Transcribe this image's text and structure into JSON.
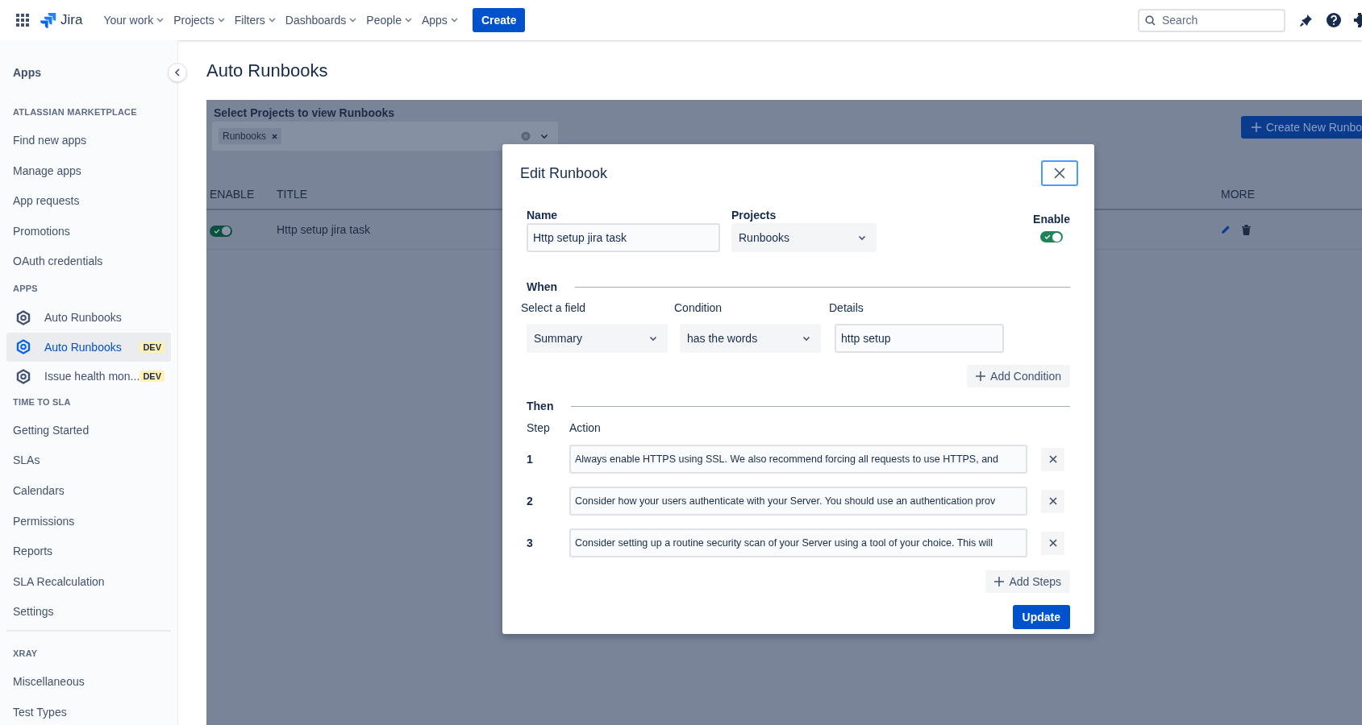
{
  "top_nav": {
    "product": "Jira",
    "menus": [
      {
        "label": "Your work"
      },
      {
        "label": "Projects"
      },
      {
        "label": "Filters"
      },
      {
        "label": "Dashboards"
      },
      {
        "label": "People"
      },
      {
        "label": "Apps"
      }
    ],
    "create_button": "Create",
    "search": {
      "placeholder": "Search"
    }
  },
  "sidebar": {
    "title": "Apps",
    "sections": [
      {
        "heading": "ATLASSIAN MARKETPLACE",
        "separated": false,
        "items": [
          {
            "kind": "link",
            "label": "Find new apps",
            "selected": false
          },
          {
            "kind": "link",
            "label": "Manage apps",
            "selected": false
          },
          {
            "kind": "link",
            "label": "App requests",
            "selected": false
          },
          {
            "kind": "link",
            "label": "Promotions",
            "selected": false
          },
          {
            "kind": "link",
            "label": "OAuth credentials",
            "selected": false
          }
        ]
      },
      {
        "heading": "APPS",
        "separated": false,
        "items": [
          {
            "kind": "app",
            "label": "Auto Runbooks",
            "selected": false
          },
          {
            "kind": "app",
            "label": "Auto Runbooks",
            "badge": "DEV",
            "selected": true
          },
          {
            "kind": "app",
            "label": "Issue health mon...",
            "badge": "DEV",
            "selected": false
          }
        ]
      },
      {
        "heading": "TIME TO SLA",
        "separated": false,
        "items": [
          {
            "kind": "link",
            "label": "Getting Started",
            "selected": false
          },
          {
            "kind": "link",
            "label": "SLAs",
            "selected": false
          },
          {
            "kind": "link",
            "label": "Calendars",
            "selected": false
          },
          {
            "kind": "link",
            "label": "Permissions",
            "selected": false
          },
          {
            "kind": "link",
            "label": "Reports",
            "selected": false
          },
          {
            "kind": "link",
            "label": "SLA Recalculation",
            "selected": false
          },
          {
            "kind": "link",
            "label": "Settings",
            "selected": false
          }
        ]
      },
      {
        "heading": "XRAY",
        "separated": true,
        "items": [
          {
            "kind": "link",
            "label": "Miscellaneous",
            "selected": false
          },
          {
            "kind": "link",
            "label": "Test Types",
            "selected": false
          }
        ]
      }
    ]
  },
  "page": {
    "title": "Auto Runbooks",
    "project_filter": {
      "label": "Select Projects to view Runbooks",
      "tags": [
        "Runbooks"
      ]
    },
    "create_button": "Create New Runbo",
    "table": {
      "columns": [
        "ENABLE",
        "TITLE",
        "MORE"
      ],
      "rows": [
        {
          "enabled": true,
          "title": "Http setup jira task"
        }
      ]
    }
  },
  "modal": {
    "title": "Edit Runbook",
    "name": {
      "label": "Name",
      "value": "Http setup jira task"
    },
    "projects": {
      "label": "Projects",
      "value": "Runbooks"
    },
    "enable": {
      "label": "Enable",
      "on": true
    },
    "when": {
      "heading": "When",
      "field": {
        "label": "Select a field",
        "value": "Summary"
      },
      "condition": {
        "label": "Condition",
        "value": "has the words"
      },
      "details": {
        "label": "Details",
        "value": "http setup"
      },
      "add_button": "Add Condition"
    },
    "then": {
      "heading": "Then",
      "columns": [
        "Step",
        "Action"
      ],
      "steps": [
        {
          "number": "1",
          "action": "Always enable HTTPS using SSL. We also recommend forcing all requests to use HTTPS, and"
        },
        {
          "number": "2",
          "action": "Consider how your users authenticate with your Server. You should use an authentication prov"
        },
        {
          "number": "3",
          "action": "Consider setting up a routine security scan of your Server using a tool of your choice. This will"
        }
      ],
      "add_button": "Add Steps"
    },
    "submit_button": "Update"
  }
}
